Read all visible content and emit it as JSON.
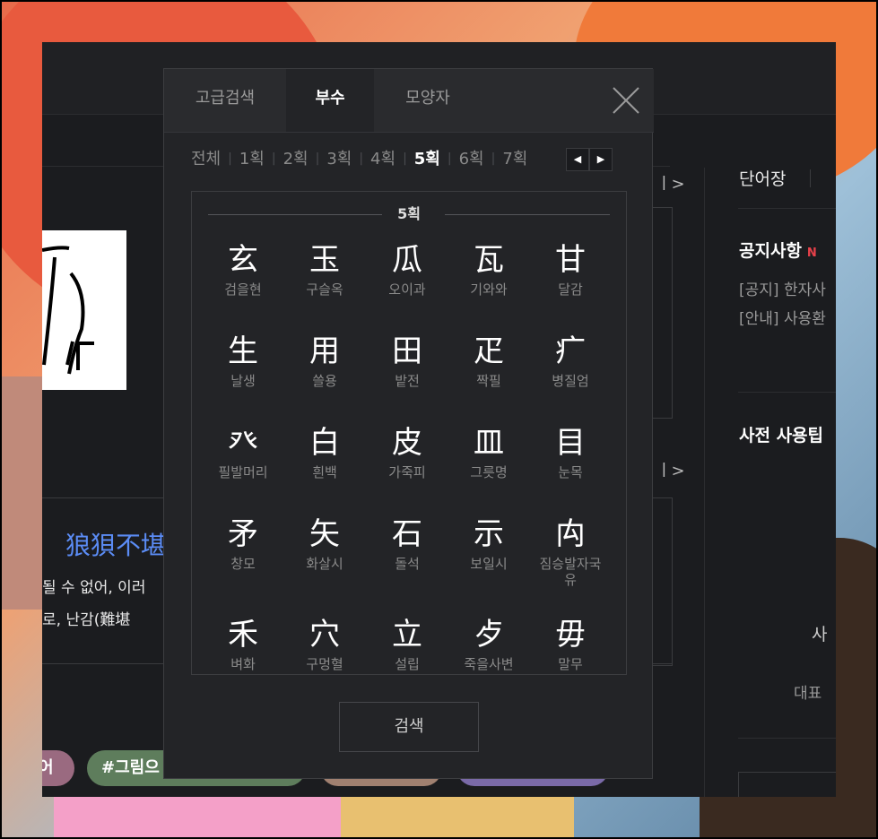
{
  "popup": {
    "tabs": [
      {
        "label": "고급검색",
        "active": false
      },
      {
        "label": "부수",
        "active": true
      },
      {
        "label": "모양자",
        "active": false
      }
    ],
    "close_icon": "close-icon",
    "stroke_filters": [
      "전체",
      "1획",
      "2획",
      "3획",
      "4획",
      "5획",
      "6획",
      "7획"
    ],
    "active_stroke": "5획",
    "nav_prev": "◀",
    "nav_next": "▶",
    "group_label": "5획",
    "radicals": [
      {
        "char": "玄",
        "reading": "검을현"
      },
      {
        "char": "玉",
        "reading": "구슬옥"
      },
      {
        "char": "瓜",
        "reading": "오이과"
      },
      {
        "char": "瓦",
        "reading": "기와와"
      },
      {
        "char": "甘",
        "reading": "달감"
      },
      {
        "char": "生",
        "reading": "날생"
      },
      {
        "char": "用",
        "reading": "쓸용"
      },
      {
        "char": "田",
        "reading": "밭전"
      },
      {
        "char": "疋",
        "reading": "짝필"
      },
      {
        "char": "疒",
        "reading": "병질엄"
      },
      {
        "char": "癶",
        "reading": "필발머리"
      },
      {
        "char": "白",
        "reading": "흰백"
      },
      {
        "char": "皮",
        "reading": "가죽피"
      },
      {
        "char": "皿",
        "reading": "그릇명"
      },
      {
        "char": "目",
        "reading": "눈목"
      },
      {
        "char": "矛",
        "reading": "창모"
      },
      {
        "char": "矢",
        "reading": "화살시"
      },
      {
        "char": "石",
        "reading": "돌석"
      },
      {
        "char": "示",
        "reading": "보일시"
      },
      {
        "char": "禸",
        "reading": "짐승발자국유"
      },
      {
        "char": "禾",
        "reading": "벼화"
      },
      {
        "char": "穴",
        "reading": "구멍혈"
      },
      {
        "char": "立",
        "reading": "설립"
      },
      {
        "char": "歺",
        "reading": "죽을사변"
      },
      {
        "char": "毋",
        "reading": "말무"
      }
    ],
    "search_button": "검색"
  },
  "page": {
    "hanja_hit": "狼狽不堪",
    "sentence1": "될 수 없어, 이러",
    "sentence2": "로, 난감(難堪",
    "more_arrow": "ㅣ>",
    "tags": [
      {
        "label": "어",
        "color": "#9a6a80"
      },
      {
        "label": "#그림으",
        "color": "#5e7d5c"
      },
      {
        "label": "",
        "color": "#a08070"
      },
      {
        "label": "",
        "color": "#7a6aa8"
      }
    ],
    "right": {
      "wordbook": "단어장",
      "notice_title": "공지사항",
      "notice_badge": "N",
      "notice_items": [
        "[공지] 한자사",
        "[안내] 사용환"
      ],
      "tips_title": "사전 사용팁",
      "side_label_1": "사",
      "side_label_2": "대표"
    }
  }
}
